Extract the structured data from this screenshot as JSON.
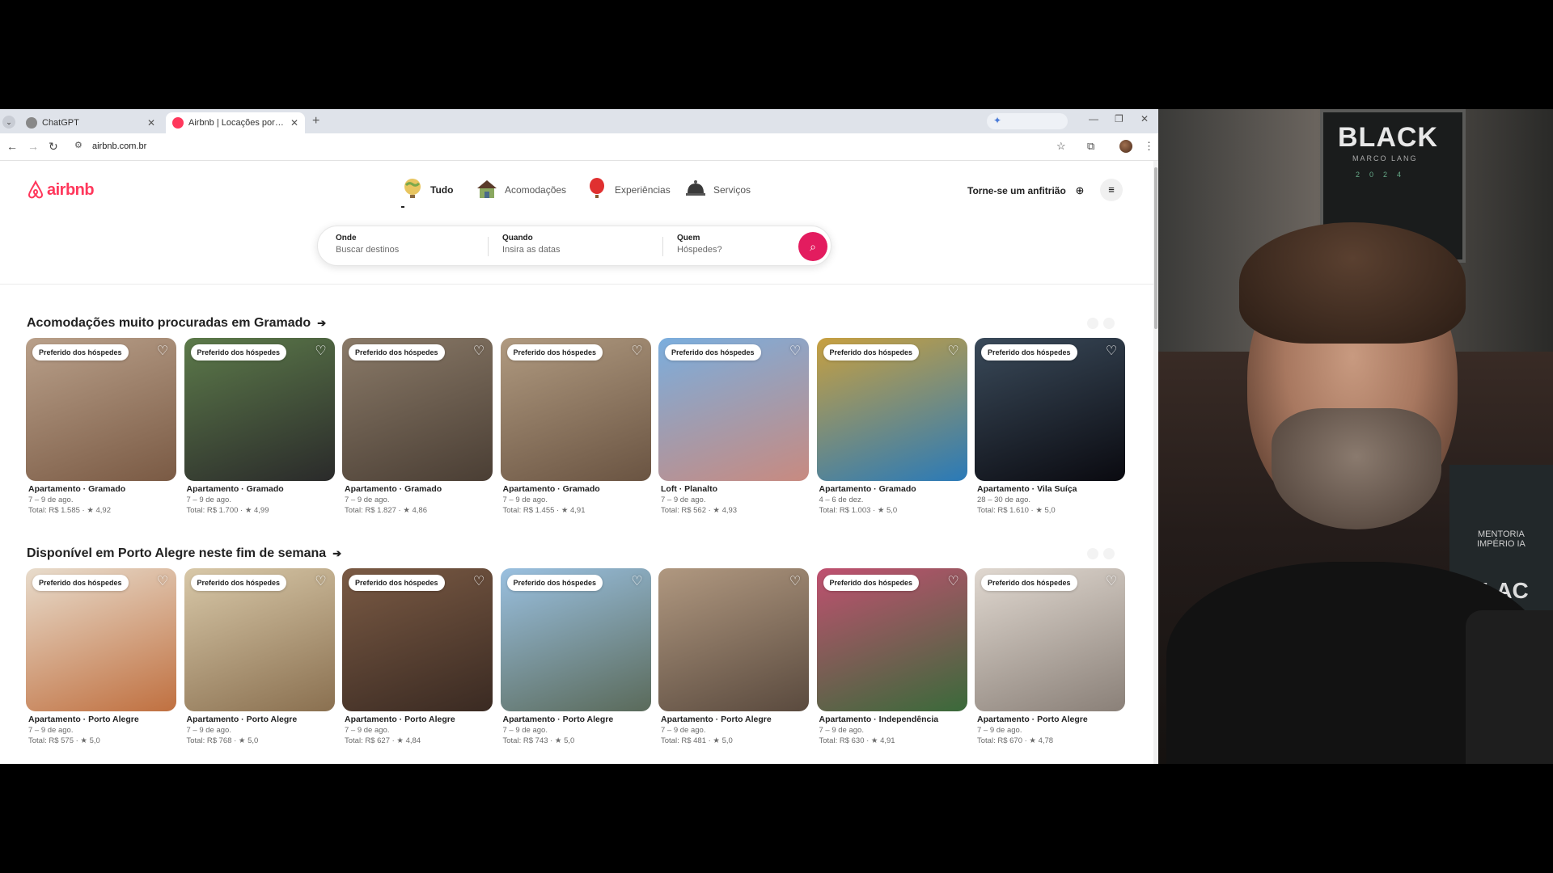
{
  "browser": {
    "tabs": [
      {
        "label": "ChatGPT",
        "favicon_color": "#6b6b6b"
      },
      {
        "label": "Airbnb | Locações por tempora",
        "favicon_color": "#ff385c"
      }
    ],
    "url": "airbnb.com.br"
  },
  "header": {
    "logo_text": "airbnb",
    "categories": [
      {
        "label": "Tudo",
        "icon": "globe-icon"
      },
      {
        "label": "Acomodações",
        "icon": "house-icon"
      },
      {
        "label": "Experiências",
        "icon": "balloon-icon"
      },
      {
        "label": "Serviços",
        "icon": "service-bell-icon"
      }
    ],
    "host_link": "Torne-se um anfitrião"
  },
  "search": {
    "where_title": "Onde",
    "where_placeholder": "Buscar destinos",
    "when_title": "Quando",
    "when_placeholder": "Insira as datas",
    "who_title": "Quem",
    "who_placeholder": "Hóspedes?"
  },
  "sections": [
    {
      "title": "Acomodações muito procuradas em Gramado",
      "cards": [
        {
          "badge": "Preferido dos hóspedes",
          "title": "Apartamento · Gramado",
          "dates": "7 – 9 de ago.",
          "price": "Total: R$ 1.585 · ★ 4,92",
          "c1": "#b9a08a",
          "c2": "#7a5a44"
        },
        {
          "badge": "Preferido dos hóspedes",
          "title": "Apartamento · Gramado",
          "dates": "7 – 9 de ago.",
          "price": "Total: R$ 1.700 · ★ 4,99",
          "c1": "#5c7a4a",
          "c2": "#2a2a2a"
        },
        {
          "badge": "Preferido dos hóspedes",
          "title": "Apartamento · Gramado",
          "dates": "7 – 9 de ago.",
          "price": "Total: R$ 1.827 · ★ 4,86",
          "c1": "#8a7a68",
          "c2": "#4a3e34"
        },
        {
          "badge": "Preferido dos hóspedes",
          "title": "Apartamento · Gramado",
          "dates": "7 – 9 de ago.",
          "price": "Total: R$ 1.455 · ★ 4,91",
          "c1": "#b09a80",
          "c2": "#6a5442"
        },
        {
          "badge": "Preferido dos hóspedes",
          "title": "Loft · Planalto",
          "dates": "7 – 9 de ago.",
          "price": "Total: R$ 562 · ★ 4,93",
          "c1": "#7aaede",
          "c2": "#c88a80"
        },
        {
          "badge": "Preferido dos hóspedes",
          "title": "Apartamento · Gramado",
          "dates": "4 – 6 de dez.",
          "price": "Total: R$ 1.003 · ★ 5,0",
          "c1": "#c8a040",
          "c2": "#2a7ab8"
        },
        {
          "badge": "Preferido dos hóspedes",
          "title": "Apartamento · Vila Suíça",
          "dates": "28 – 30 de ago.",
          "price": "Total: R$ 1.610 · ★ 5,0",
          "c1": "#3a4a5a",
          "c2": "#0a0a10"
        }
      ]
    },
    {
      "title": "Disponível em Porto Alegre neste fim de semana",
      "cards": [
        {
          "badge": "Preferido dos hóspedes",
          "title": "Apartamento · Porto Alegre",
          "dates": "7 – 9 de ago.",
          "price": "Total: R$ 575 · ★ 5,0",
          "c1": "#e8dccc",
          "c2": "#c07040"
        },
        {
          "badge": "Preferido dos hóspedes",
          "title": "Apartamento · Porto Alegre",
          "dates": "7 – 9 de ago.",
          "price": "Total: R$ 768 · ★ 5,0",
          "c1": "#d8c8a8",
          "c2": "#8a7050"
        },
        {
          "badge": "Preferido dos hóspedes",
          "title": "Apartamento · Porto Alegre",
          "dates": "7 – 9 de ago.",
          "price": "Total: R$ 627 · ★ 4,84",
          "c1": "#7a5a44",
          "c2": "#3a2a22"
        },
        {
          "badge": "Preferido dos hóspedes",
          "title": "Apartamento · Porto Alegre",
          "dates": "7 – 9 de ago.",
          "price": "Total: R$ 743 · ★ 5,0",
          "c1": "#9ac0e0",
          "c2": "#5a6a5a"
        },
        {
          "badge": "",
          "title": "Apartamento · Porto Alegre",
          "dates": "7 – 9 de ago.",
          "price": "Total: R$ 481 · ★ 5,0",
          "c1": "#b09880",
          "c2": "#5a4a3e"
        },
        {
          "badge": "Preferido dos hóspedes",
          "title": "Apartamento · Independência",
          "dates": "7 – 9 de ago.",
          "price": "Total: R$ 630 · ★ 4,91",
          "c1": "#c05070",
          "c2": "#3a6a3a"
        },
        {
          "badge": "Preferido dos hóspedes",
          "title": "Apartamento · Porto Alegre",
          "dates": "7 – 9 de ago.",
          "price": "Total: R$ 670 · ★ 4,78",
          "c1": "#e0d8d0",
          "c2": "#8a8078"
        }
      ]
    }
  ],
  "webcam": {
    "poster_title": "BLACK",
    "poster_name": "MARCO LANG",
    "poster_year": "2024",
    "sign_line1": "MENTORIA",
    "sign_line2": "IMPÉRIO IA",
    "sign_big": "BLAC"
  }
}
